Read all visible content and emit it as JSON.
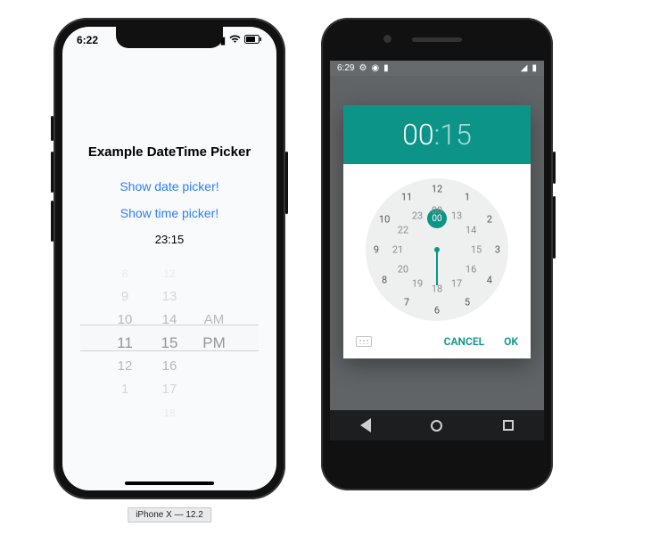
{
  "ios": {
    "status_time": "6:22",
    "title": "Example DateTime Picker",
    "link_date": "Show date picker!",
    "link_time": "Show time picker!",
    "current_time": "23:15",
    "wheel": {
      "rows": [
        {
          "h": "8",
          "m": "12",
          "p": ""
        },
        {
          "h": "9",
          "m": "13",
          "p": ""
        },
        {
          "h": "10",
          "m": "14",
          "p": "AM"
        },
        {
          "h": "11",
          "m": "15",
          "p": "PM"
        },
        {
          "h": "12",
          "m": "16",
          "p": ""
        },
        {
          "h": "1",
          "m": "17",
          "p": ""
        },
        {
          "h": "",
          "m": "18",
          "p": ""
        }
      ]
    },
    "device_label": "iPhone X — 12.2"
  },
  "android": {
    "status_time": "6:29",
    "hour": "00",
    "minute": "15",
    "selected_inner": "00",
    "cancel": "CANCEL",
    "ok": "OK",
    "outer_numbers": [
      "12",
      "1",
      "2",
      "3",
      "4",
      "5",
      "6",
      "7",
      "8",
      "9",
      "10",
      "11"
    ],
    "inner_numbers": [
      "00",
      "13",
      "14",
      "15",
      "16",
      "17",
      "18",
      "19",
      "20",
      "21",
      "22",
      "23"
    ]
  },
  "colors": {
    "ios_link": "#2f7cf6",
    "android_accent": "#0d9488"
  }
}
